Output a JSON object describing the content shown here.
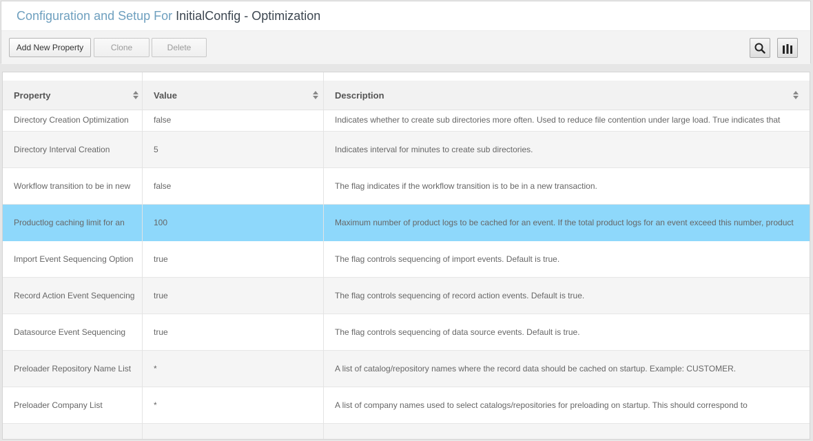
{
  "header": {
    "title_prefix": "Configuration and Setup For",
    "title_config": "InitialConfig - Optimization"
  },
  "toolbar": {
    "add_label": "Add New Property",
    "clone_label": "Clone",
    "delete_label": "Delete",
    "search_icon": "search-icon",
    "columns_icon": "columns-icon"
  },
  "grid": {
    "columns": [
      "Property",
      "Value",
      "Description"
    ],
    "selected_color": "#8ed8fb",
    "rows": [
      {
        "property": "Directory Creation Optimization",
        "value": "false",
        "description": "Indicates whether to create sub directories more often. Used to reduce file contention under large load. True indicates that"
      },
      {
        "property": "Directory Interval Creation",
        "value": "5",
        "description": "Indicates interval for minutes to create sub directories."
      },
      {
        "property": "Workflow transition to be in new",
        "value": "false",
        "description": "The flag indicates if the workflow transition is to be in a new transaction."
      },
      {
        "property": "Productlog caching limit for an",
        "value": "100",
        "description": "Maximum number of product logs to be cached for an event. If the total product logs for an event exceed this number, product"
      },
      {
        "property": "Import Event Sequencing Option",
        "value": "true",
        "description": "The flag controls sequencing of import events. Default is true."
      },
      {
        "property": "Record Action Event Sequencing",
        "value": "true",
        "description": "The flag controls sequencing of record action events. Default is true."
      },
      {
        "property": "Datasource Event Sequencing",
        "value": "true",
        "description": "The flag controls sequencing of data source events. Default is true."
      },
      {
        "property": "Preloader Repository Name List",
        "value": "*",
        "description": "A list of catalog/repository names where the record data should be cached on startup. Example: CUSTOMER."
      },
      {
        "property": "Preloader Company List",
        "value": "*",
        "description": "A list of company names used to select catalogs/repositories for preloading on startup. This should correspond to"
      }
    ]
  }
}
